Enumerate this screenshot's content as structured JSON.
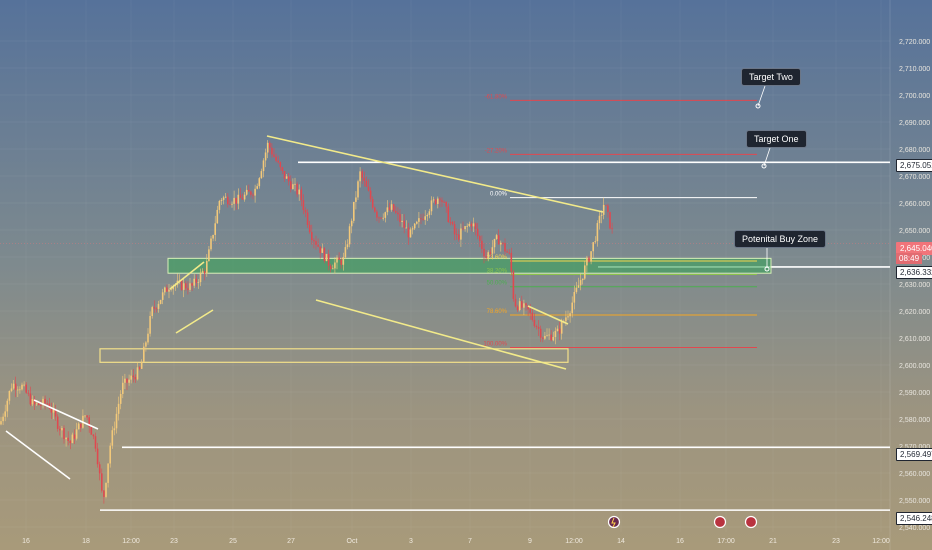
{
  "chart_data": {
    "type": "candlestick",
    "y_axis": {
      "ticks": [
        "2,720.000",
        "2,710.000",
        "2,700.000",
        "2,690.000",
        "2,680.000",
        "2,670.000",
        "2,660.000",
        "2,650.000",
        "2,640.000",
        "2,630.000",
        "2,620.000",
        "2,610.000",
        "2,600.000",
        "2,590.000",
        "2,580.000",
        "2,570.000",
        "2,560.000",
        "2,550.000",
        "2,540.000"
      ],
      "ylim": [
        2545,
        2730
      ]
    },
    "x_axis": {
      "ticks": [
        "16",
        "18",
        "12:00",
        "23",
        "25",
        "27",
        "Oct",
        "3",
        "7",
        "9",
        "12:00",
        "14",
        "16",
        "17:00",
        "21",
        "23",
        "12:00"
      ]
    },
    "price_badges": {
      "current": "2,645.040",
      "countdown": "08:49",
      "resistance": "2,675.051",
      "buy_zone": "2,636.332",
      "support_mid": "2,569.497",
      "support_low": "2,546.248"
    },
    "annotations": {
      "target_two": "Target Two",
      "target_one": "Target One",
      "buy_zone": "Potenital Buy Zone"
    },
    "fib_levels": [
      {
        "label": "-61.80%",
        "price": 2698.0,
        "color": "#e0484f"
      },
      {
        "label": "-27.20%",
        "price": 2678.0,
        "color": "#e0484f"
      },
      {
        "label": "0.00%",
        "price": 2662.0,
        "color": "#ffffff"
      },
      {
        "label": "23.60%",
        "price": 2638.5,
        "color": "#f3d54e"
      },
      {
        "label": "38.20%",
        "price": 2633.5,
        "color": "#8bc34a"
      },
      {
        "label": "50.00%",
        "price": 2629.0,
        "color": "#4caf50"
      },
      {
        "label": "78.60%",
        "price": 2618.5,
        "color": "#f5a623"
      },
      {
        "label": "100.00%",
        "price": 2606.5,
        "color": "#e0484f"
      }
    ],
    "horizontal_levels": [
      2675.051,
      2636.332,
      2569.497,
      2546.248
    ],
    "zones": [
      {
        "name": "buy-zone",
        "top": 2639.5,
        "bottom": 2634.0,
        "color": "#3aa45a"
      },
      {
        "name": "demand-box",
        "top": 2606.0,
        "bottom": 2601.0,
        "color": "#f3e08a"
      }
    ],
    "candles": {
      "up_color": "#f3c97a",
      "down_color": "#e0484f",
      "waypoints": [
        [
          0,
          2578
        ],
        [
          12,
          2593
        ],
        [
          22,
          2592
        ],
        [
          34,
          2585
        ],
        [
          48,
          2586
        ],
        [
          58,
          2578
        ],
        [
          70,
          2571
        ],
        [
          86,
          2582
        ],
        [
          96,
          2570
        ],
        [
          103,
          2549
        ],
        [
          110,
          2570
        ],
        [
          122,
          2592
        ],
        [
          140,
          2598
        ],
        [
          152,
          2620
        ],
        [
          170,
          2630
        ],
        [
          192,
          2629
        ],
        [
          206,
          2636
        ],
        [
          220,
          2662
        ],
        [
          238,
          2661
        ],
        [
          255,
          2665
        ],
        [
          268,
          2682
        ],
        [
          282,
          2671
        ],
        [
          300,
          2663
        ],
        [
          312,
          2648
        ],
        [
          330,
          2637
        ],
        [
          344,
          2639
        ],
        [
          360,
          2671
        ],
        [
          378,
          2655
        ],
        [
          392,
          2658
        ],
        [
          410,
          2648
        ],
        [
          426,
          2657
        ],
        [
          440,
          2663
        ],
        [
          456,
          2647
        ],
        [
          472,
          2653
        ],
        [
          486,
          2640
        ],
        [
          498,
          2647
        ],
        [
          510,
          2640
        ],
        [
          514,
          2623
        ],
        [
          528,
          2620
        ],
        [
          544,
          2610
        ],
        [
          558,
          2612
        ],
        [
          570,
          2621
        ],
        [
          580,
          2631
        ],
        [
          592,
          2643
        ],
        [
          604,
          2660
        ],
        [
          614,
          2647
        ]
      ]
    }
  }
}
